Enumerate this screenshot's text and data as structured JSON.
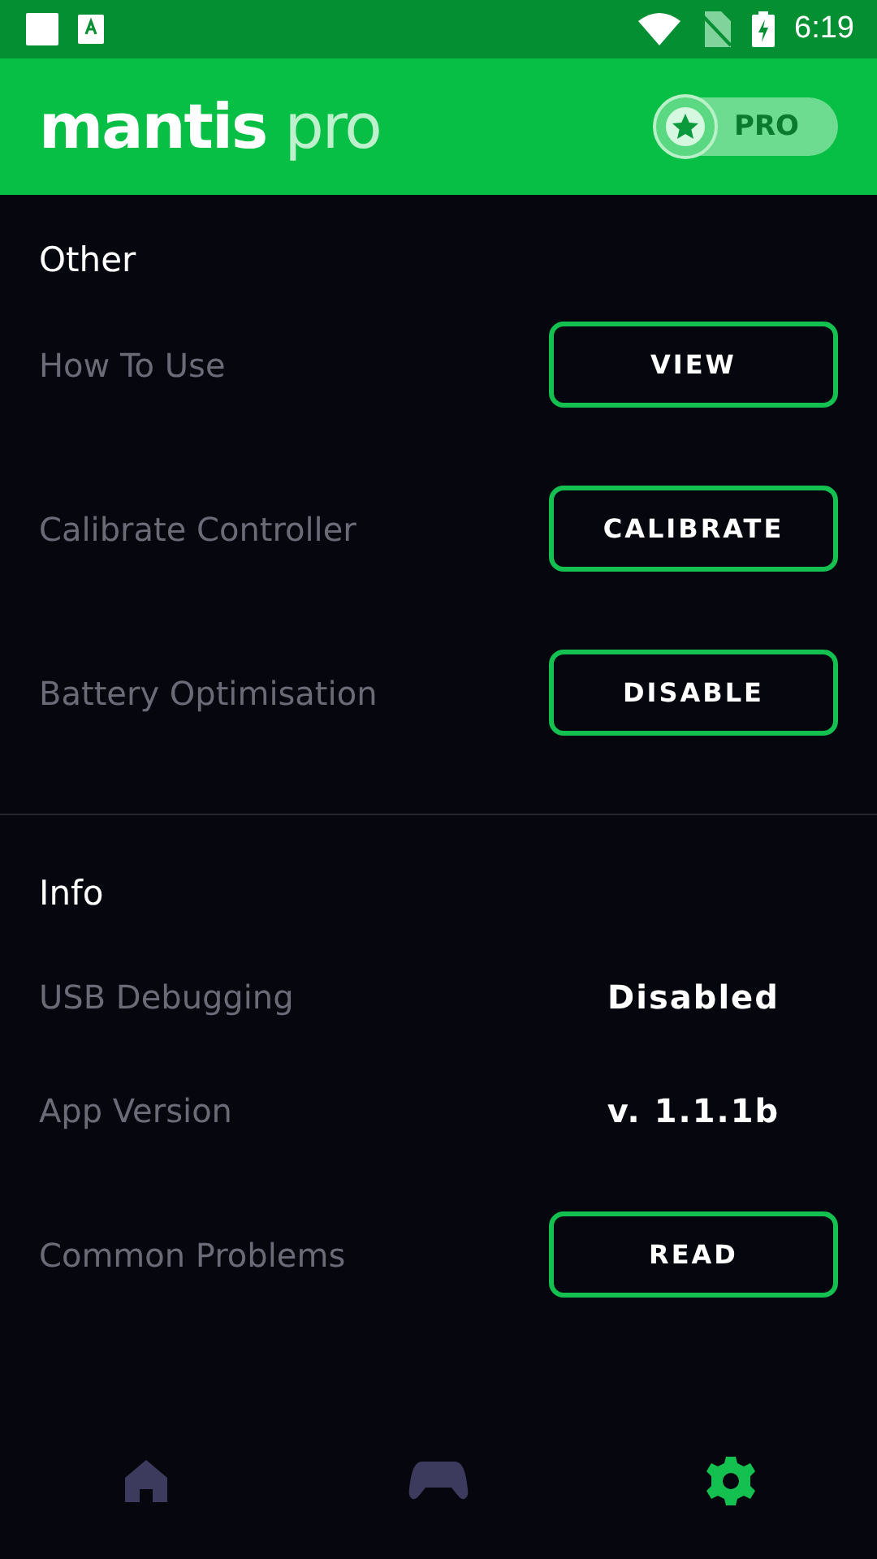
{
  "status_bar": {
    "time": "6:19"
  },
  "app_bar": {
    "title_main": "mantis",
    "title_accent": "pro",
    "pro_toggle": {
      "label": "PRO",
      "on": true
    }
  },
  "sections": [
    {
      "title": "Other",
      "rows": [
        {
          "kind": "button",
          "label": "How To Use",
          "action": "VIEW"
        },
        {
          "kind": "button",
          "label": "Calibrate Controller",
          "action": "CALIBRATE"
        },
        {
          "kind": "button",
          "label": "Battery Optimisation",
          "action": "DISABLE"
        }
      ]
    },
    {
      "title": "Info",
      "rows": [
        {
          "kind": "value",
          "label": "USB Debugging",
          "value": "Disabled"
        },
        {
          "kind": "value",
          "label": "App Version",
          "value": "v. 1.1.1b"
        },
        {
          "kind": "button",
          "label": "Common Problems",
          "action": "READ"
        }
      ]
    }
  ],
  "bottom_nav": [
    {
      "kind": "home",
      "selected": false
    },
    {
      "kind": "gamepad",
      "selected": false
    },
    {
      "kind": "settings",
      "selected": true
    }
  ]
}
